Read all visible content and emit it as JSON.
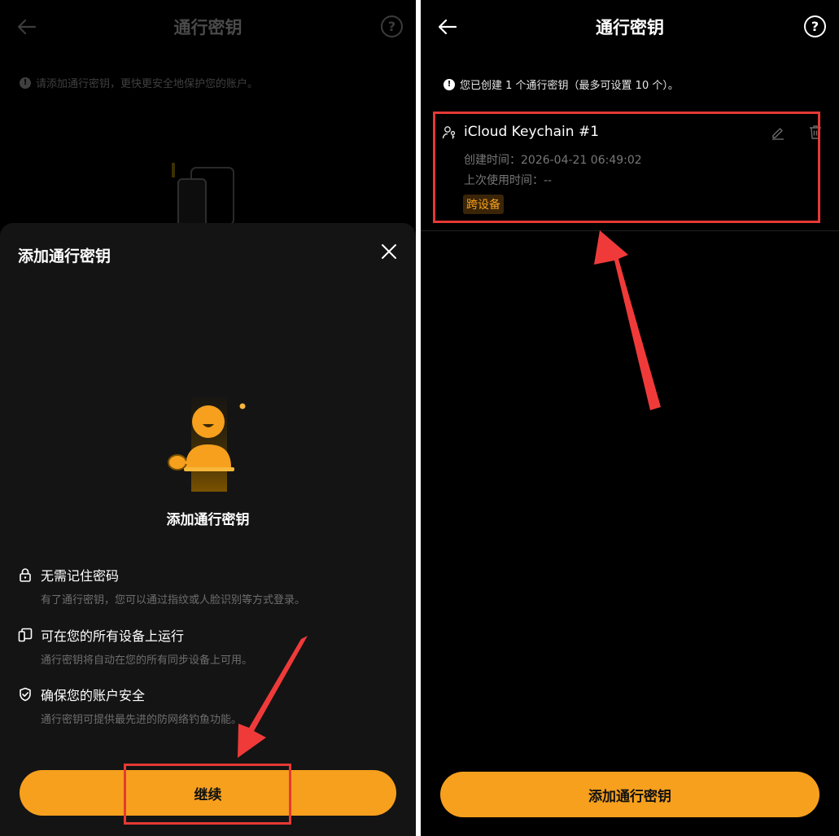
{
  "left": {
    "header": {
      "title": "通行密钥"
    },
    "notice": {
      "icon": "exclamation-icon",
      "text": "请添加通行密钥，更快更安全地保护您的账户。"
    },
    "sheet": {
      "title": "添加通行密钥",
      "hero_caption": "添加通行密钥",
      "features": [
        {
          "icon": "lock-icon",
          "title": "无需记住密码",
          "desc": "有了通行密钥，您可以通过指纹或人脸识别等方式登录。"
        },
        {
          "icon": "devices-icon",
          "title": "可在您的所有设备上运行",
          "desc": "通行密钥将自动在您的所有同步设备上可用。"
        },
        {
          "icon": "shield-check-icon",
          "title": "确保您的账户安全",
          "desc": "通行密钥可提供最先进的防网络钓鱼功能。"
        }
      ],
      "continue_label": "继续"
    }
  },
  "right": {
    "header": {
      "title": "通行密钥"
    },
    "notice": {
      "icon": "exclamation-icon",
      "text": "您已创建 1 个通行密钥（最多可设置 10 个）。"
    },
    "passkey": {
      "name": "iCloud Keychain #1",
      "created": "创建时间：2026-04-21 06:49:02",
      "last_used": "上次使用时间：--",
      "badge": "跨设备"
    },
    "add_label": "添加通行密钥"
  },
  "colors": {
    "accent": "#f6a01e",
    "annotation": "#e53935",
    "background": "#000000",
    "sheet": "#141414"
  }
}
